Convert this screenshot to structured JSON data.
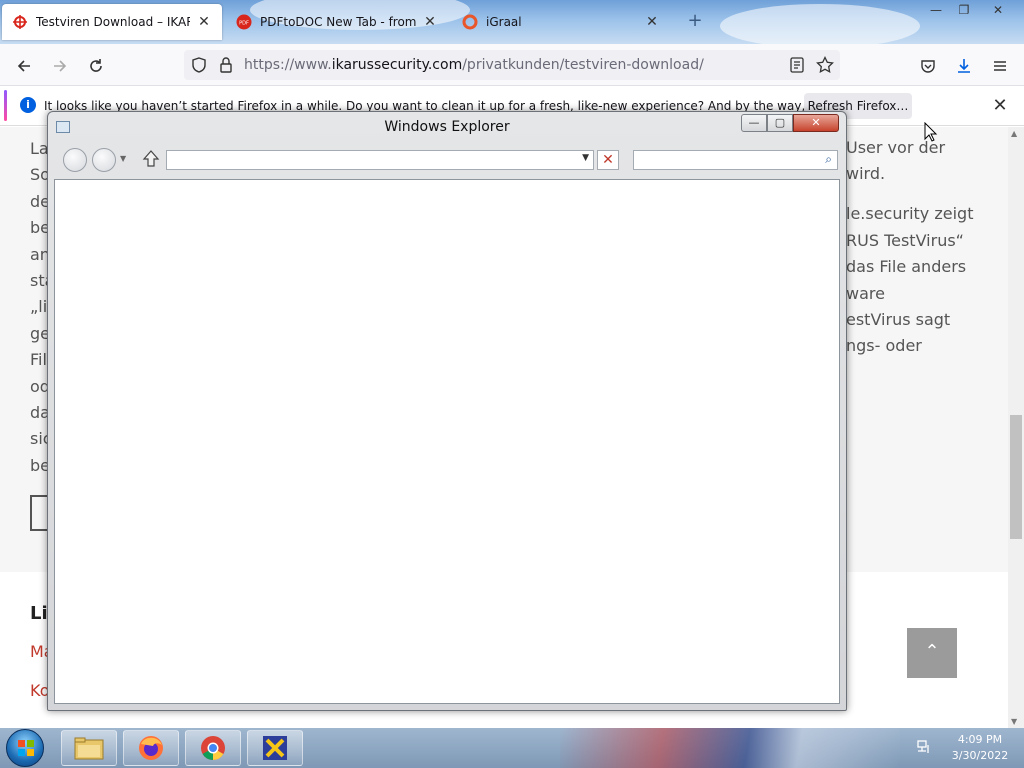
{
  "browser": {
    "tabs": [
      {
        "title": "Testviren Download – IKARUS S",
        "active": true,
        "icon": "ikarus-icon"
      },
      {
        "title": "PDFtoDOC New Tab - frompdft",
        "active": false,
        "icon": "pdf-icon"
      },
      {
        "title": "iGraal",
        "active": false,
        "icon": "igraal-icon"
      }
    ],
    "url_prefix": "https://www.",
    "url_domain": "ikarussecurity.com",
    "url_path": "/privatkunden/testviren-download/",
    "notification": {
      "message": "It looks like you haven’t started Firefox in a while. Do you want to clean it up for a fresh, like-new experience? And by the way, welcome back!",
      "button": "Refresh Firefox…"
    }
  },
  "page": {
    "left_fragments": [
      "La",
      "So",
      "de",
      "be",
      "an",
      "sta",
      "„liv",
      "ge",
      "Fil",
      "od",
      "da",
      "sic",
      "be"
    ],
    "right_lines": [
      "User vor der",
      "wird.",
      "le.security zeigt",
      "RUS TestVirus“",
      "das File anders",
      "ware",
      "estVirus sagt",
      "ngs- oder"
    ],
    "footer_heading": "Li",
    "footer_links": [
      "Ma",
      "Ko"
    ],
    "to_top_label": "⌃"
  },
  "explorer": {
    "title": "Windows Explorer",
    "address_value": "",
    "search_value": ""
  },
  "taskbar": {
    "time": "4:09 PM",
    "date": "3/30/2022"
  },
  "colors": {
    "accent_red": "#c0392b",
    "firefox_blue": "#0060df"
  }
}
